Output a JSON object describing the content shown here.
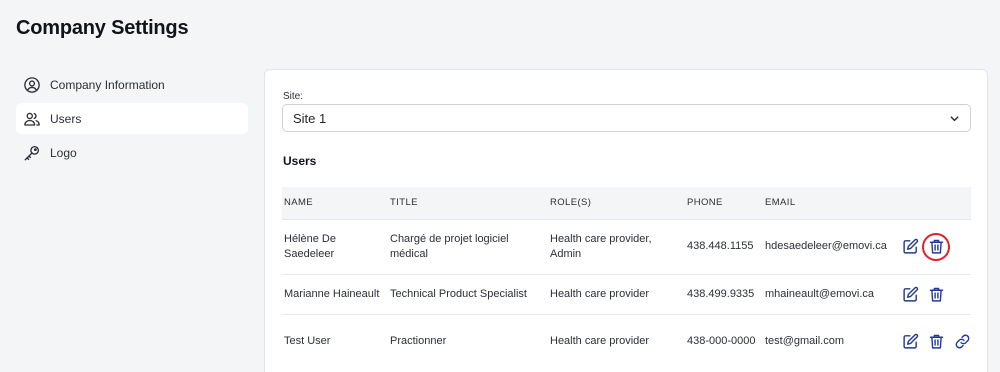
{
  "page": {
    "title": "Company Settings"
  },
  "sidebar": {
    "items": [
      {
        "label": "Company Information",
        "icon": "user-circle-icon",
        "active": false
      },
      {
        "label": "Users",
        "icon": "users-icon",
        "active": true
      },
      {
        "label": "Logo",
        "icon": "key-icon",
        "active": false
      }
    ]
  },
  "site": {
    "label": "Site:",
    "selected": "Site 1"
  },
  "users": {
    "title": "Users",
    "columns": [
      "NAME",
      "TITLE",
      "ROLE(S)",
      "PHONE",
      "EMAIL"
    ],
    "rows": [
      {
        "name": "Hélène De Saedeleer",
        "title": "Chargé de projet logiciel médical",
        "roles": "Health care provider, Admin",
        "phone": "438.448.1155",
        "email": "hdesaedeleer@emovi.ca"
      },
      {
        "name": "Marianne Haineault",
        "title": "Technical Product Specialist",
        "roles": "Health care provider",
        "phone": "438.499.9335",
        "email": "mhaineault@emovi.ca"
      },
      {
        "name": "Test User",
        "title": "Practionner",
        "roles": "Health care provider",
        "phone": "438-000-0000",
        "email": "test@gmail.com"
      }
    ]
  },
  "colors": {
    "accent": "#1f3a93",
    "highlight_ring": "#e0202a",
    "active_nav_bg": "#ffffff"
  }
}
